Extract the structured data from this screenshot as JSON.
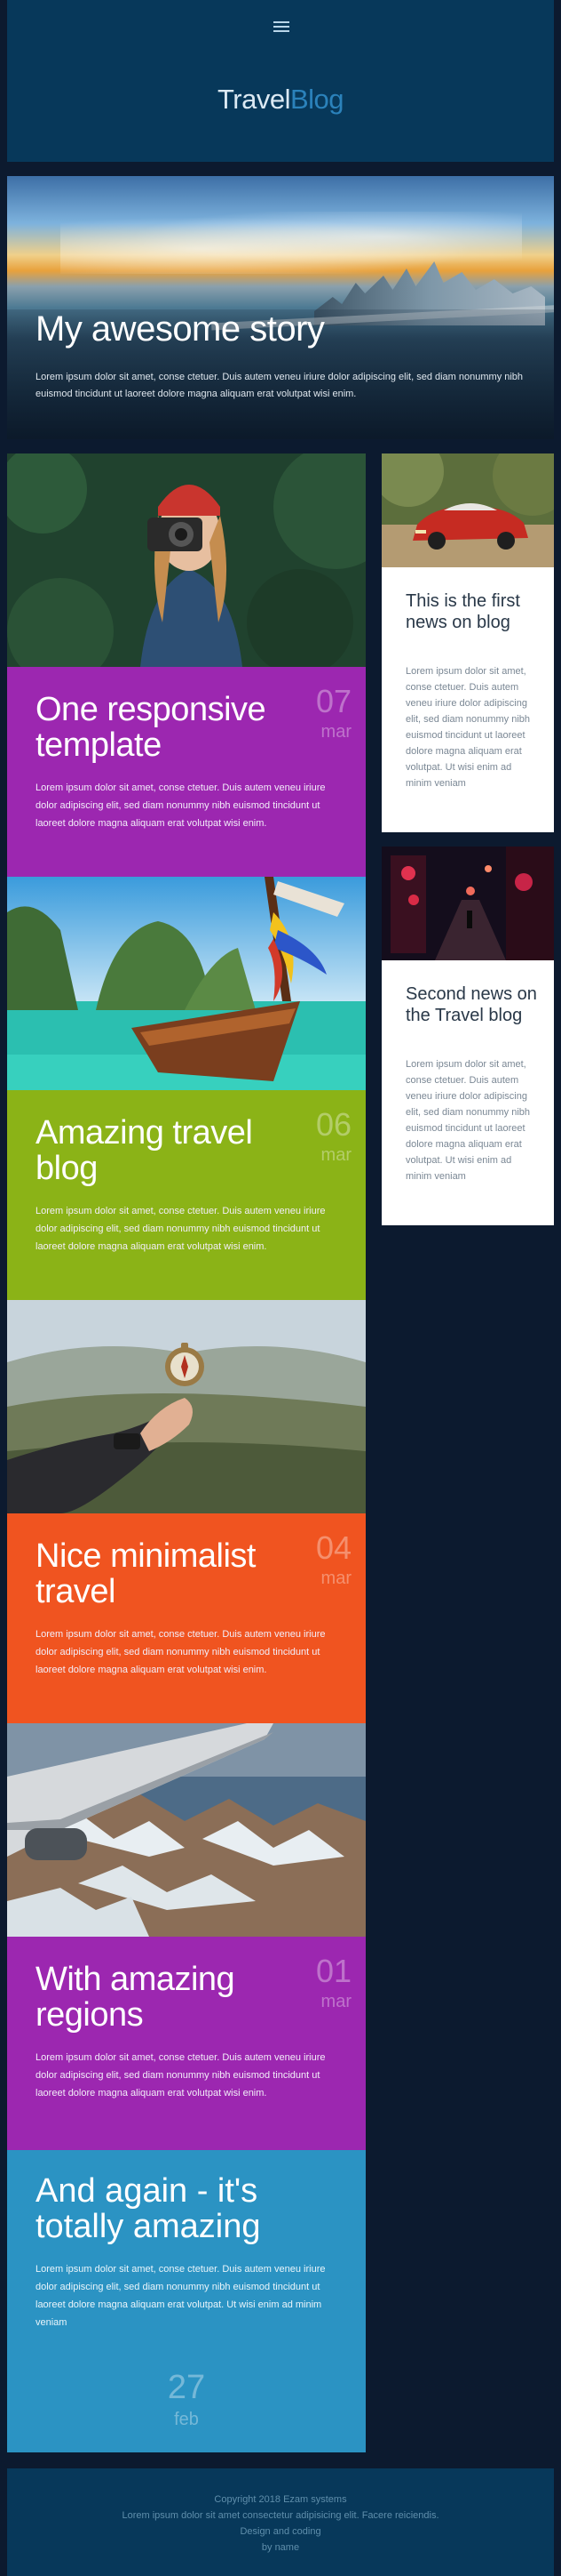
{
  "header": {
    "menu_icon": "hamburger-icon",
    "logo_part1": "Travel",
    "logo_part2": "Blog",
    "colors": {
      "part1": "#dbe9f3",
      "part2": "#2b82bb",
      "background": "#07385a"
    }
  },
  "hero": {
    "title": "My awesome story",
    "text": "Lorem ipsum dolor sit amet, conse ctetuer. Duis autem veneu iriure dolor adipiscing elit, sed diam nonummy nibh euismod tincidunt ut laoreet dolore magna aliquam erat volutpat wisi enim."
  },
  "posts": [
    {
      "title": "One responsive template",
      "day": "07",
      "month": "mar",
      "color": "#9c27b0",
      "text": "Lorem ipsum dolor sit amet, conse ctetuer. Duis autem veneu iriure dolor adipiscing elit, sed diam nonummy nibh euismod tincidunt ut laoreet dolore magna aliquam erat volutpat wisi enim."
    },
    {
      "title": "Amazing travel blog",
      "day": "06",
      "month": "mar",
      "color": "#8bb317",
      "text": "Lorem ipsum dolor sit amet, conse ctetuer. Duis autem veneu iriure dolor adipiscing elit, sed diam nonummy nibh euismod tincidunt ut laoreet dolore magna aliquam erat volutpat wisi enim."
    },
    {
      "title": "Nice minimalist travel",
      "day": "04",
      "month": "mar",
      "color": "#f05420",
      "text": "Lorem ipsum dolor sit amet, conse ctetuer. Duis autem veneu iriure dolor adipiscing elit, sed diam nonummy nibh euismod tincidunt ut laoreet dolore magna aliquam erat volutpat wisi enim."
    },
    {
      "title": "With amazing regions",
      "day": "01",
      "month": "mar",
      "color": "#9c27b0",
      "text": "Lorem ipsum dolor sit amet, conse ctetuer. Duis autem veneu iriure dolor adipiscing elit, sed diam nonummy nibh euismod tincidunt ut laoreet dolore magna aliquam erat volutpat wisi enim."
    }
  ],
  "last_post": {
    "title": "And again - it's totally amazing",
    "text": "Lorem ipsum dolor sit amet, conse ctetuer. Duis autem veneu iriure dolor adipiscing elit, sed diam nonummy nibh euismod tincidunt ut laoreet dolore magna aliquam erat volutpat. Ut wisi enim ad minim veniam",
    "day": "27",
    "month": "feb",
    "color": "#2b93c3"
  },
  "news": [
    {
      "title": "This is the first news on blog",
      "text": "Lorem ipsum dolor sit amet, conse ctetuer. Duis autem veneu iriure dolor adipiscing elit, sed diam nonummy nibh euismod tincidunt ut laoreet dolore magna aliquam erat volutpat. Ut wisi enim ad minim veniam"
    },
    {
      "title": "Second news on the Travel blog",
      "text": "Lorem ipsum dolor sit amet, conse ctetuer. Duis autem veneu iriure dolor adipiscing elit, sed diam nonummy nibh euismod tincidunt ut laoreet dolore magna aliquam erat volutpat. Ut wisi enim ad minim veniam"
    }
  ],
  "footer": {
    "copyright": "Copyright 2018 Ezam systems",
    "text": "Lorem ipsum dolor sit amet consectetur adipisicing elit. Facere reiciendis.",
    "credit": "Design and coding",
    "author": "by name"
  }
}
